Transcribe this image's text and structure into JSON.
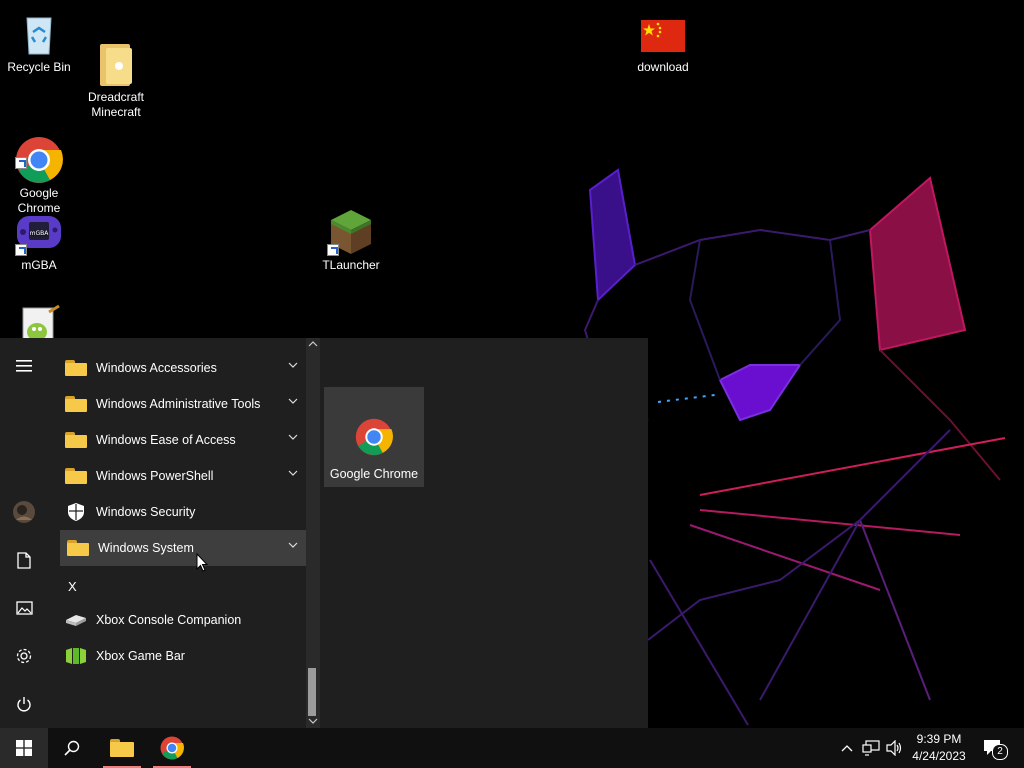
{
  "desktop": {
    "icons": [
      {
        "label": "Recycle Bin",
        "icon": "recycle-bin-icon"
      },
      {
        "label": "Dreadcraft\nMinecraft",
        "icon": "folder-icon"
      },
      {
        "label": "download",
        "icon": "chinese-flag-icon"
      },
      {
        "label": "Google\nChrome",
        "icon": "chrome-icon"
      },
      {
        "label": "mGBA",
        "icon": "gameboy-advance-icon"
      },
      {
        "label": "TLauncher",
        "icon": "minecraft-grass-block-icon"
      },
      {
        "label": "",
        "icon": "notepad-plus-plus-icon"
      }
    ]
  },
  "start_menu": {
    "rail": [
      "hamburger-menu-icon",
      "user-avatar",
      "documents-icon",
      "pictures-icon",
      "settings-gear-icon",
      "power-icon"
    ],
    "apps": [
      {
        "label": "Windows Accessories",
        "icon": "folder-icon",
        "expandable": true
      },
      {
        "label": "Windows Administrative Tools",
        "icon": "folder-icon",
        "expandable": true
      },
      {
        "label": "Windows Ease of Access",
        "icon": "folder-icon",
        "expandable": true
      },
      {
        "label": "Windows PowerShell",
        "icon": "folder-icon",
        "expandable": true
      },
      {
        "label": "Windows Security",
        "icon": "shield-icon",
        "expandable": false
      },
      {
        "label": "Windows System",
        "icon": "folder-icon",
        "expandable": true,
        "selected": true
      },
      {
        "label": "Xbox Console Companion",
        "icon": "xbox-console-icon",
        "expandable": false
      },
      {
        "label": "Xbox Game Bar",
        "icon": "xbox-game-bar-icon",
        "expandable": false
      }
    ],
    "section_letter": "X",
    "tile": {
      "label": "Google Chrome",
      "icon": "chrome-icon"
    }
  },
  "taskbar": {
    "items": [
      "windows-start-icon",
      "search-icon",
      "file-explorer-icon",
      "chrome-icon"
    ],
    "tray": [
      "chevron-up-icon",
      "network-icon",
      "volume-icon"
    ],
    "time": "9:39 PM",
    "date": "4/24/2023",
    "notification_count": "2"
  }
}
